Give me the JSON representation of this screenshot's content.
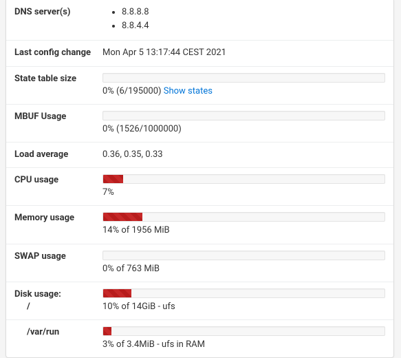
{
  "dns": {
    "label": "DNS server(s)",
    "servers": [
      "8.8.8.8",
      "8.8.4.4"
    ]
  },
  "last_config": {
    "label": "Last config change",
    "value": "Mon Apr 5 13:17:44 CEST 2021"
  },
  "state_table": {
    "label": "State table size",
    "percent": 0,
    "text": "0% (6/195000) ",
    "link_text": "Show states"
  },
  "mbuf": {
    "label": "MBUF Usage",
    "percent": 0,
    "text": "0% (1526/1000000)"
  },
  "load": {
    "label": "Load average",
    "value": "0.36, 0.35, 0.33"
  },
  "cpu": {
    "label": "CPU usage",
    "percent": 7,
    "text": "7%"
  },
  "memory": {
    "label": "Memory usage",
    "percent": 14,
    "text": "14% of 1956 MiB"
  },
  "swap": {
    "label": "SWAP usage",
    "percent": 0,
    "text": "0% of 763 MiB"
  },
  "disk_root": {
    "label": "Disk usage:",
    "mount": "/",
    "percent": 10,
    "text": "10% of 14GiB - ufs"
  },
  "disk_varrun": {
    "mount": "/var/run",
    "percent": 3,
    "text": "3% of 3.4MiB - ufs in RAM"
  }
}
